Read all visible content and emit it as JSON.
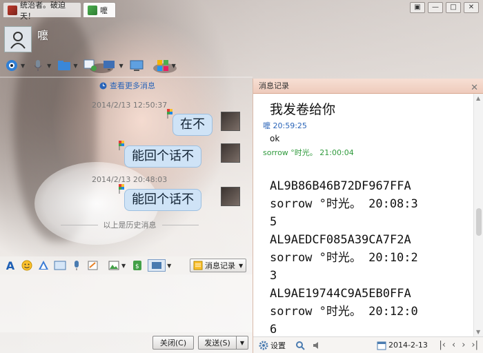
{
  "tabs": [
    {
      "label": "统治者。破迫天！"
    },
    {
      "label": "嚒"
    }
  ],
  "contact": {
    "name": "嚒"
  },
  "chat": {
    "more_messages": "查看更多消息",
    "entries": [
      {
        "timestamp": "2014/2/13 12:50:37",
        "text": "在不"
      },
      {
        "text": "能回个话不"
      },
      {
        "timestamp": "2014/2/13 20:48:03",
        "text": "能回个话不"
      }
    ],
    "history_divider": "以上是历史消息"
  },
  "input_toolbar": {
    "message_record_label": "消息记录"
  },
  "buttons": {
    "close": "关闭(C)",
    "send": "发送(S)"
  },
  "panel": {
    "title": "消息记录",
    "messages": [
      {
        "kind": "text-big",
        "text": "我发卷给你"
      },
      {
        "kind": "sender-blue",
        "text": "嚒 20:59:25"
      },
      {
        "kind": "text",
        "text": "ok"
      },
      {
        "kind": "sender-green",
        "text": "sorrow °时光。 21:00:04"
      }
    ],
    "log_lines": [
      "AL9B86B46B72DF967FFA",
      "sorrow °时光。 20:08:3",
      "5",
      "AL9AEDCF085A39CA7F2A",
      "sorrow °时光。 20:10:2",
      "3",
      "AL9AE19744C9A5EB0FFA",
      "sorrow °时光。 20:12:0",
      "6"
    ],
    "footer": {
      "settings": "设置",
      "date": "2014-2-13"
    }
  },
  "colors": {
    "bubble": "#cfe3f6",
    "panel_header": "#eecbbc",
    "link": "#2a64b8"
  }
}
